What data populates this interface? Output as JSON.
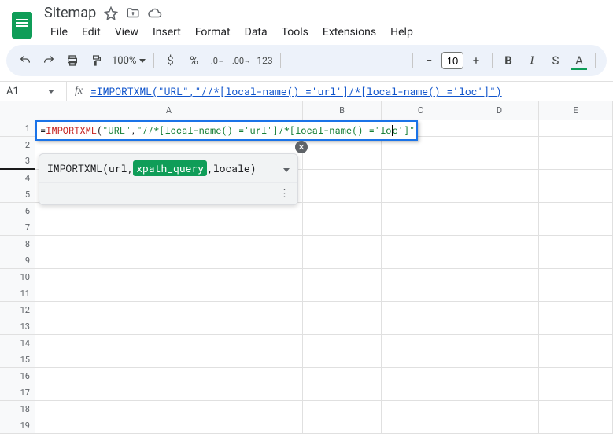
{
  "doc": {
    "title": "Sitemap"
  },
  "menus": [
    "File",
    "Edit",
    "View",
    "Insert",
    "Format",
    "Data",
    "Tools",
    "Extensions",
    "Help"
  ],
  "toolbar": {
    "zoom": "100%",
    "font_size": "10",
    "paste_format": "123",
    "currency": "$",
    "percent": "%",
    "dec_dec": ".0",
    "inc_dec": ".00"
  },
  "formula_bar": {
    "cell_ref": "A1",
    "fx_label": "fx",
    "formula_display": "=IMPORTXML(\"URL\",\"//*[local-name() ='url']/*[local-name() ='loc']\")"
  },
  "columns": [
    "A",
    "B",
    "C",
    "D",
    "E"
  ],
  "rows": [
    "1",
    "2",
    "3",
    "4",
    "5",
    "6",
    "7",
    "8",
    "9",
    "10",
    "11",
    "12",
    "13",
    "14",
    "15",
    "16",
    "17",
    "18",
    "19"
  ],
  "active_cell": {
    "eq": "=",
    "fn": "IMPORTXML",
    "open": "(",
    "arg1": "\"URL\"",
    "comma": ",",
    "arg2a": "\"//*[local-name() ='url']/*[local-name() ='lo",
    "arg2b": "c']\"",
    "close": ")"
  },
  "hint": {
    "fn": "IMPORTXML",
    "open": "(",
    "arg1": "url",
    "sep1": ", ",
    "arg2": "xpath_query",
    "sep2": ", ",
    "arg3": "locale",
    "close": ")"
  }
}
